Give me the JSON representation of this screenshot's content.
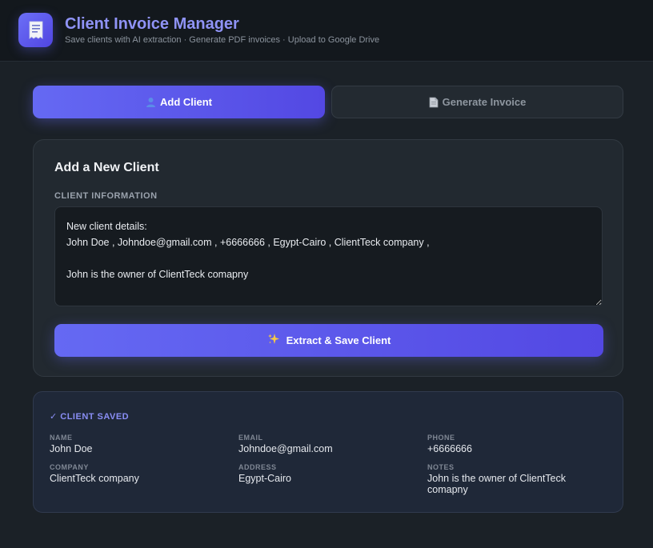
{
  "header": {
    "title": "Client Invoice Manager",
    "subtitle": "Save clients with AI extraction · Generate PDF invoices · Upload to Google Drive",
    "logo_icon": "invoice-icon"
  },
  "tabs": [
    {
      "label": "Add Client",
      "icon": "user-icon",
      "active": true
    },
    {
      "label": "Generate Invoice",
      "icon": "document-icon",
      "active": false
    }
  ],
  "add_client": {
    "title": "Add a New Client",
    "field_label": "CLIENT INFORMATION",
    "textarea_value": "New client details:\nJohn Doe , Johndoe@gmail.com , +6666666 , Egypt-Cairo , ClientTeck company ,\n\nJohn is the owner of ClientTeck comapny",
    "button_label": "Extract & Save Client",
    "button_icon": "sparkles-icon"
  },
  "saved": {
    "title": "✓ CLIENT SAVED",
    "fields": [
      {
        "label": "NAME",
        "value": "John Doe"
      },
      {
        "label": "EMAIL",
        "value": "Johndoe@gmail.com"
      },
      {
        "label": "PHONE",
        "value": "+6666666"
      },
      {
        "label": "COMPANY",
        "value": "ClientTeck company"
      },
      {
        "label": "ADDRESS",
        "value": "Egypt-Cairo"
      },
      {
        "label": "NOTES",
        "value": "John is the owner of ClientTeck comapny"
      }
    ]
  },
  "colors": {
    "accent": "#6366f1",
    "background": "#1b2127",
    "header": "#13181d"
  }
}
